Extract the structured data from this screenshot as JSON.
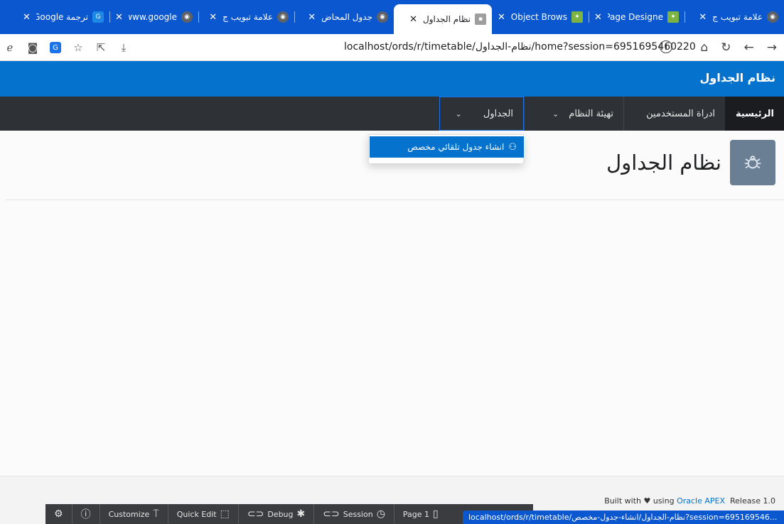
{
  "browser": {
    "tabs": [
      {
        "title": "علامة تبويب ج",
        "favicon": "globe-icon"
      },
      {
        "title": "Page Designe",
        "favicon": "apex-icon"
      },
      {
        "title": "Object Brows",
        "favicon": "apex-icon"
      },
      {
        "title": "نظام الجداول",
        "favicon": "apex-app-icon",
        "active": true
      },
      {
        "title": "جدول المحاض",
        "favicon": "globe-icon"
      },
      {
        "title": "علامة تبويب ج",
        "favicon": "globe-icon"
      },
      {
        "title": "www.google.",
        "favicon": "globe-icon"
      },
      {
        "title": "ترجمة Google",
        "favicon": "translate-icon"
      }
    ],
    "url": "localhost/ords/r/timetable/نظام-الجداول/home?session=6951695460220",
    "hover_url": "localhost/ords/r/timetable/نظام-الجداول/انشاء-جدول-مخصص?session=695169546..."
  },
  "app": {
    "title": "نظام الجداول",
    "page_title": "نظام الجداول"
  },
  "menu": {
    "items": [
      {
        "label": "الرئيسية"
      },
      {
        "label": "ادراة المستخدمين"
      },
      {
        "label": "تهيئة النظام"
      },
      {
        "label": "الجداول"
      }
    ],
    "dropdown_item": "انشاء جدول تلقائي مخصص"
  },
  "footer": {
    "built_with": "Built with",
    "using": "using",
    "apex_link": "Oracle APEX",
    "release": "Release 1.0"
  },
  "devbar": {
    "customize": "Customize",
    "quick_edit": "Quick Edit",
    "debug": "Debug",
    "session": "Session",
    "page": "Page 1"
  }
}
